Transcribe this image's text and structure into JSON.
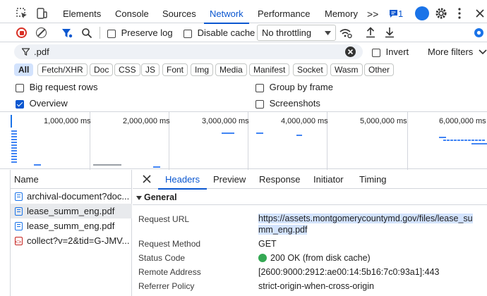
{
  "tabs": [
    {
      "label": "Elements"
    },
    {
      "label": "Console"
    },
    {
      "label": "Sources"
    },
    {
      "label": "Network"
    },
    {
      "label": "Performance"
    },
    {
      "label": "Memory"
    }
  ],
  "more_tabs": ">>",
  "issues_count": "1",
  "toolbar": {
    "preserve_log": "Preserve log",
    "disable_cache": "Disable cache",
    "throttling": "No throttling"
  },
  "filter": {
    "value": ".pdf",
    "invert": "Invert",
    "more_filters": "More filters"
  },
  "types": [
    "All",
    "Fetch/XHR",
    "Doc",
    "CSS",
    "JS",
    "Font",
    "Img",
    "Media",
    "Manifest",
    "Socket",
    "Wasm",
    "Other"
  ],
  "options": {
    "big_request_rows": "Big request rows",
    "group_by_frame": "Group by frame",
    "overview": "Overview",
    "screenshots": "Screenshots"
  },
  "overview_ticks": [
    "1,000,000 ms",
    "2,000,000 ms",
    "3,000,000 ms",
    "4,000,000 ms",
    "5,000,000 ms",
    "6,000,000 ms"
  ],
  "name_header": "Name",
  "files": [
    {
      "name": "archival-document?doc...",
      "icon": "document-icon"
    },
    {
      "name": "lease_summ_eng.pdf",
      "icon": "document-icon"
    },
    {
      "name": "lease_summ_eng.pdf",
      "icon": "document-icon"
    },
    {
      "name": "collect?v=2&tid=G-JMV...",
      "icon": "script-icon"
    }
  ],
  "detail_tabs": [
    "Headers",
    "Preview",
    "Response",
    "Initiator",
    "Timing"
  ],
  "general_label": "General",
  "headers": {
    "request_url_label": "Request URL",
    "request_url_line1": "https://assets.montgomerycountymd.gov/files/lease_su",
    "request_url_line2": "mm_eng.pdf",
    "request_method_label": "Request Method",
    "request_method": "GET",
    "status_code_label": "Status Code",
    "status_code": "200 OK (from disk cache)",
    "remote_address_label": "Remote Address",
    "remote_address": "[2600:9000:2912:ae00:14:5b16:7c0:93a1]:443",
    "referrer_policy_label": "Referrer Policy",
    "referrer_policy": "strict-origin-when-cross-origin"
  },
  "colors": {
    "accent": "#0b57d0",
    "status_ok": "#34a853",
    "bar": "#4285f4"
  }
}
